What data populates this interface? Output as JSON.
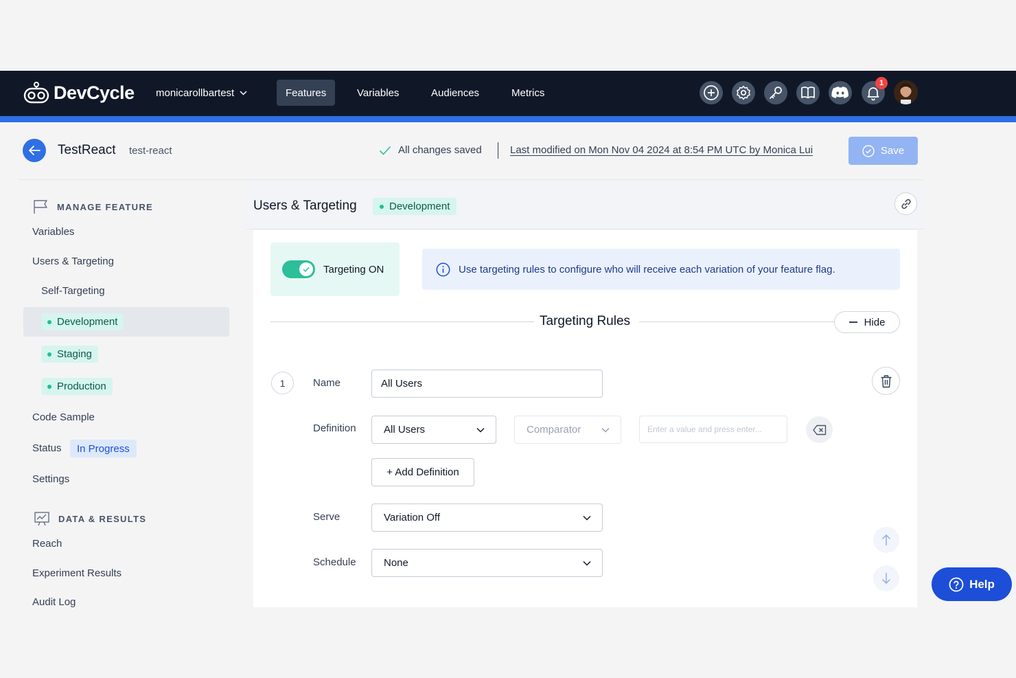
{
  "brand": {
    "name": "DevCycle",
    "accent": "#2f6fe4",
    "nav_bg": "#101828"
  },
  "org": {
    "name": "monicarollbartest"
  },
  "nav": {
    "tabs": [
      {
        "label": "Features",
        "active": true
      },
      {
        "label": "Variables"
      },
      {
        "label": "Audiences"
      },
      {
        "label": "Metrics"
      }
    ]
  },
  "nav_icons": [
    "plus-circle-icon",
    "gear-icon",
    "key-icon",
    "book-icon",
    "discord-icon",
    "bell-icon",
    "avatar"
  ],
  "notifications": {
    "count": "1"
  },
  "feature": {
    "name": "TestReact",
    "key": "test-react"
  },
  "save_status": {
    "saved_text": "All changes saved",
    "modified_text": "Last modified on Mon Nov 04 2024 at 8:54 PM UTC by Monica Lui",
    "save_label": "Save"
  },
  "sidebar": {
    "manage_heading": "MANAGE FEATURE",
    "variables": "Variables",
    "users_targeting": "Users & Targeting",
    "self_targeting": "Self-Targeting",
    "environments": [
      "Development",
      "Staging",
      "Production"
    ],
    "code_sample": "Code Sample",
    "status_label": "Status",
    "status_value": "In Progress",
    "settings": "Settings",
    "data_heading": "DATA & RESULTS",
    "reach": "Reach",
    "experiment_results": "Experiment Results",
    "audit_log": "Audit Log"
  },
  "panel": {
    "title": "Users & Targeting",
    "environment": "Development",
    "targeting_label": "Targeting ON",
    "targeting_on": true,
    "info_text": "Use targeting rules to configure who will receive each variation of your feature flag.",
    "rules_title": "Targeting Rules",
    "hide_label": "Hide"
  },
  "rule": {
    "number": "1",
    "name_label": "Name",
    "name_value": "All Users",
    "definition_label": "Definition",
    "definition_value": "All Users",
    "comparator_placeholder": "Comparator",
    "value_placeholder": "Enter a value and press enter...",
    "add_definition": "+ Add Definition",
    "serve_label": "Serve",
    "serve_value": "Variation Off",
    "schedule_label": "Schedule",
    "schedule_value": "None"
  },
  "help": {
    "label": "Help"
  }
}
